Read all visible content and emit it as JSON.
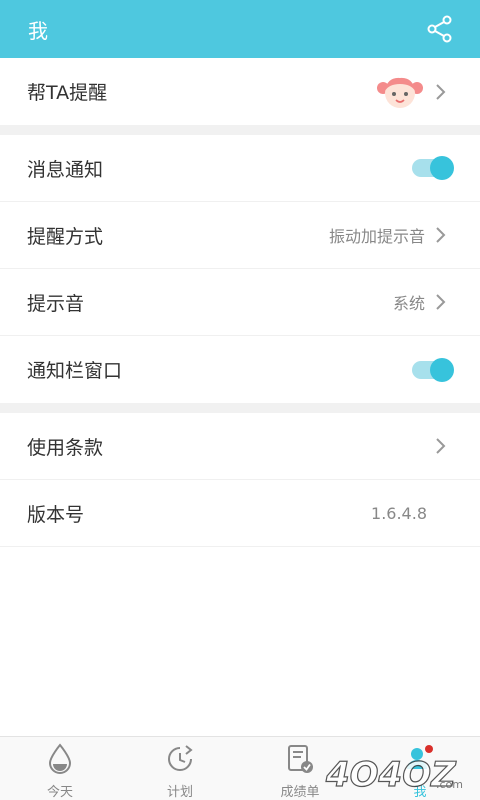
{
  "header": {
    "title": "我",
    "share_icon": "share-icon"
  },
  "settings": {
    "help_ta": {
      "label": "帮TA提醒",
      "icon": "girl-avatar-icon"
    },
    "notifications": {
      "label": "消息通知",
      "enabled": true
    },
    "reminder_mode": {
      "label": "提醒方式",
      "value": "振动加提示音"
    },
    "sound": {
      "label": "提示音",
      "value": "系统"
    },
    "notif_bar": {
      "label": "通知栏窗口",
      "enabled": true
    },
    "terms": {
      "label": "使用条款"
    },
    "version": {
      "label": "版本号",
      "value": "1.6.4.8"
    }
  },
  "bottom_nav": {
    "items": [
      {
        "label": "今天",
        "icon": "water-drop-icon"
      },
      {
        "label": "计划",
        "icon": "clock-icon"
      },
      {
        "label": "成绩单",
        "icon": "report-check-icon"
      },
      {
        "label": "我",
        "icon": "profile-icon",
        "active": true
      }
    ]
  },
  "watermark": {
    "text": "4O4OZ.com"
  },
  "colors": {
    "accent": "#4ec8df",
    "toggle": "#37c3dc"
  }
}
